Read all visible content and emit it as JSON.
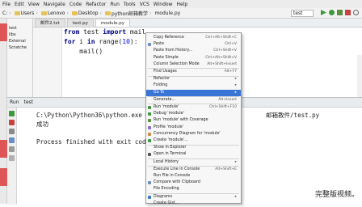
{
  "menu": [
    "File",
    "Edit",
    "View",
    "Navigate",
    "Code",
    "Refactor",
    "Run",
    "Tools",
    "VCS",
    "Window",
    "Help"
  ],
  "breadcrumb": [
    "C:",
    "Users",
    "Lenovo",
    "Desktop",
    "python邮箱教学",
    "module.py"
  ],
  "run_config": "test",
  "project_items": [
    "test",
    "libs",
    "External",
    "Scratche"
  ],
  "editor_tabs": [
    "邮件2.txt",
    "test.py",
    "module.py"
  ],
  "code": {
    "line1_kw1": "from",
    "line1_mod": " test ",
    "line1_kw2": "import",
    "line1_name": " mail",
    "line2_kw": "for",
    "line2_rest": " i ",
    "line2_kw2": "in",
    "line2_fn": " range(",
    "line2_num": "10",
    "line2_end": "):",
    "line3": "    mail()"
  },
  "run": {
    "header_label": "Run",
    "header_tab": "test",
    "line1": "C:\\Python\\Python36\\python.exe C:/Us",
    "line1b": "邮箱教件/test.py",
    "line2": "成功",
    "line3": "Process finished with exit code 0"
  },
  "context_menu": {
    "items": [
      {
        "label": "Copy Reference",
        "sc": "Ctrl+Alt+Shift+C"
      },
      {
        "label": "Paste",
        "sc": "Ctrl+V"
      },
      {
        "label": "Paste from History...",
        "sc": "Ctrl+Shift+V"
      },
      {
        "label": "Paste Simple",
        "sc": "Ctrl+Alt+Shift+V"
      },
      {
        "label": "Column Selection Mode",
        "sc": "Alt+Shift+Insert"
      },
      {
        "label": "Find Usages",
        "sc": "Alt+F7"
      },
      {
        "label": "Refactor",
        "sc": "▸"
      },
      {
        "label": "Folding",
        "sc": "▸"
      },
      {
        "label": "Go To",
        "sc": "▸"
      },
      {
        "label": "Generate...",
        "sc": "Alt+Insert"
      },
      {
        "label": "Run 'module'",
        "sc": "Ctrl+Shift+F10"
      },
      {
        "label": "Debug 'module'",
        "sc": ""
      },
      {
        "label": "Run 'module' with Coverage",
        "sc": ""
      },
      {
        "label": "Profile 'module'",
        "sc": ""
      },
      {
        "label": "Concurrency Diagram for 'module'",
        "sc": ""
      },
      {
        "label": "Create 'module'...",
        "sc": ""
      },
      {
        "label": "Show in Explorer",
        "sc": ""
      },
      {
        "label": "Open in Terminal",
        "sc": ""
      },
      {
        "label": "Local History",
        "sc": "▸"
      },
      {
        "label": "Execute Line in Console",
        "sc": "Alt+Shift+E"
      },
      {
        "label": "Run File in Console",
        "sc": ""
      },
      {
        "label": "Compare with Clipboard",
        "sc": ""
      },
      {
        "label": "File Encoding",
        "sc": ""
      },
      {
        "label": "Diagrams",
        "sc": "▸"
      },
      {
        "label": "Create Gist...",
        "sc": ""
      }
    ]
  },
  "watermark": "完整版视频。"
}
